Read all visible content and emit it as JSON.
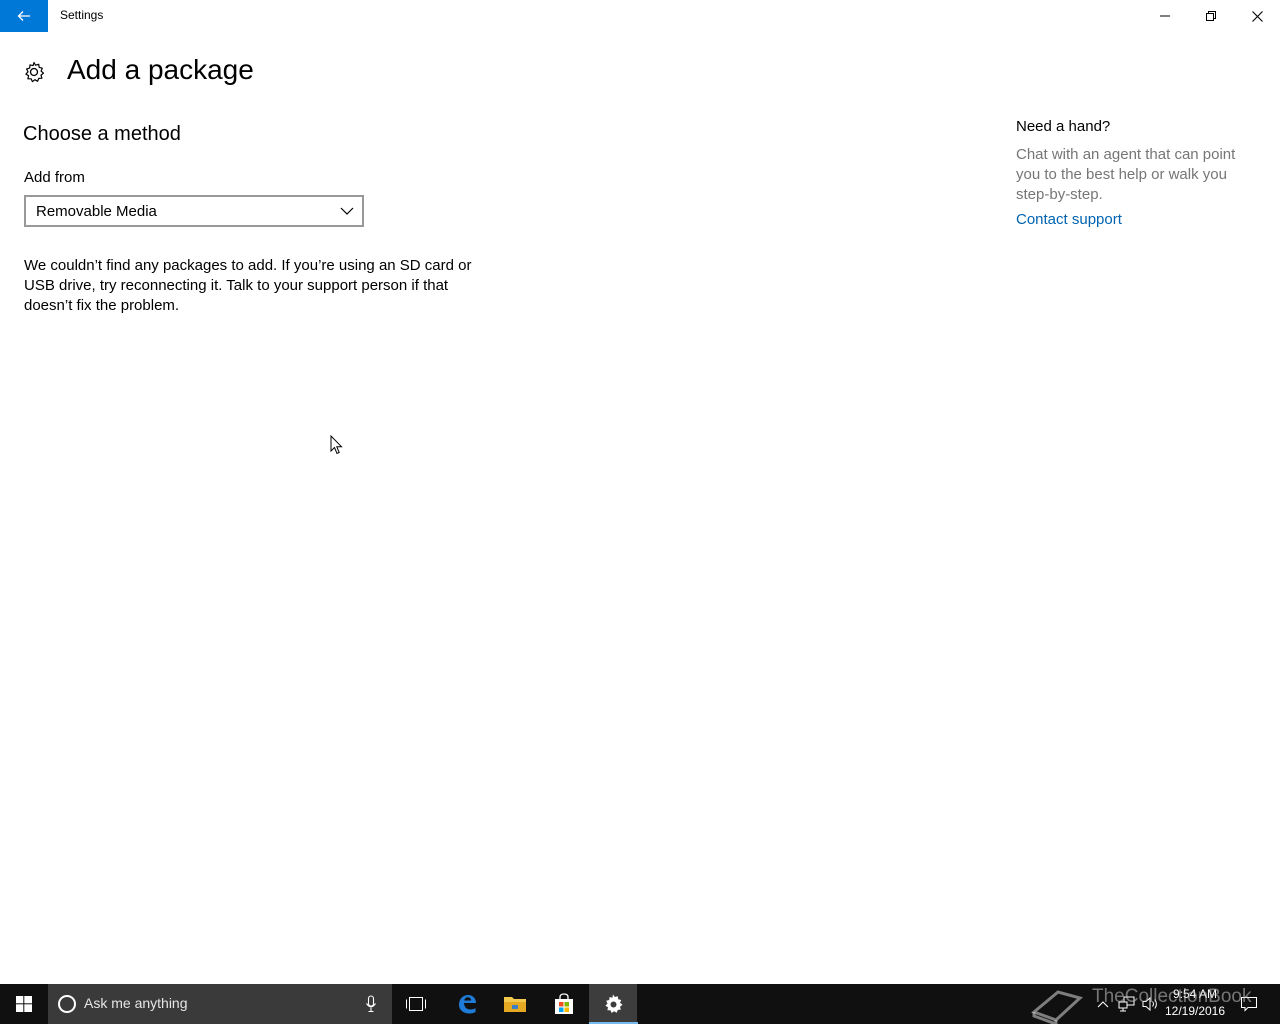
{
  "window": {
    "app_title": "Settings",
    "back_icon": "back-arrow-icon",
    "controls": [
      "minimize",
      "restore",
      "close"
    ]
  },
  "page": {
    "title": "Add a package",
    "icon": "gear-icon"
  },
  "method": {
    "section_title": "Choose a method",
    "field_label": "Add from",
    "dropdown_value": "Removable Media",
    "message": "We couldn’t find any packages to add. If you’re using an SD card or USB drive, try reconnecting it. Talk to your support person if that doesn’t fix the problem."
  },
  "help": {
    "title": "Need a hand?",
    "text": "Chat with an agent that can point you to the best help or walk you step-by-step.",
    "link": "Contact support"
  },
  "taskbar": {
    "search_placeholder": "Ask me anything",
    "time": "9:54 AM",
    "date": "12/19/2016"
  },
  "watermark": {
    "text": "TheCollectionBook"
  },
  "colors": {
    "accent": "#0078d7",
    "link": "#0063b1",
    "taskbar": "#101010",
    "secondary_text": "#767676"
  }
}
